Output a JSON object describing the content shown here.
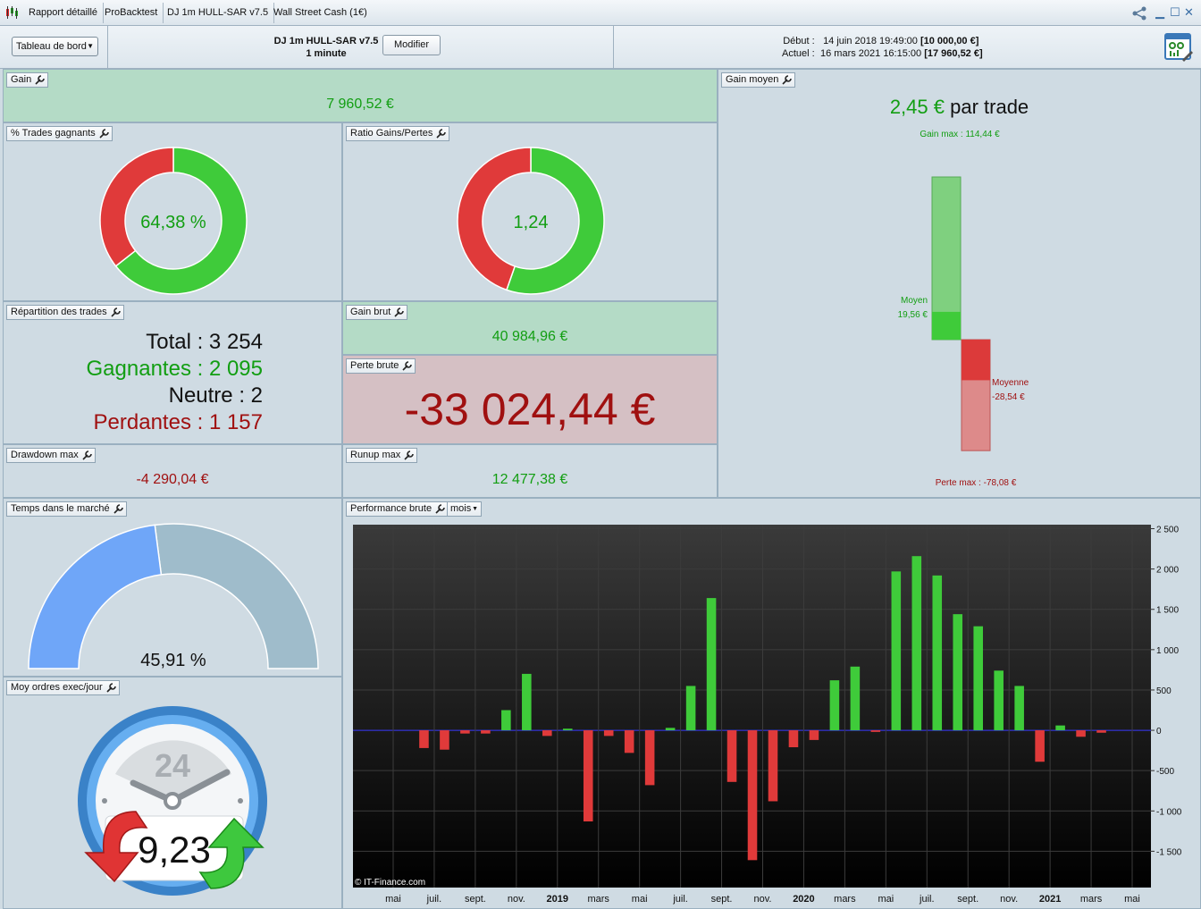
{
  "tabs": [
    "Rapport détaillé",
    "ProBacktest",
    "DJ 1m HULL-SAR v7.5",
    "Wall Street Cash (1€)"
  ],
  "header": {
    "dashboard_label": "Tableau de bord",
    "strategy_name": "DJ 1m HULL-SAR v7.5",
    "timeframe": "1 minute",
    "modify_label": "Modifier",
    "start_label": "Début :",
    "start_date": "14 juin 2018 19:49:00",
    "start_capital": "[10 000,00 €]",
    "current_label": "Actuel :",
    "current_date": "16 mars 2021 16:15:00",
    "current_capital": "[17 960,52 €]"
  },
  "panels": {
    "gain": {
      "title": "Gain",
      "value": "7 960,52 €"
    },
    "win_rate": {
      "title": "% Trades gagnants",
      "value": "64,38 %",
      "fraction": 0.6438
    },
    "ratio": {
      "title": "Ratio Gains/Pertes",
      "value": "1,24",
      "fraction": 0.5536
    },
    "gain_moyen": {
      "title": "Gain moyen",
      "value_num": "2,45 €",
      "value_suffix": "par trade",
      "gain_max_label": "Gain max : 114,44 €",
      "moyen_label": "Moyen",
      "moyen_value": "19,56 €",
      "moyenne_label": "Moyenne",
      "moyenne_value": "-28,54 €",
      "perte_max_label": "Perte max : -78,08 €",
      "gain_max": 114.44,
      "gain_avg": 19.56,
      "loss_avg": -28.54,
      "loss_max": -78.08
    },
    "repartition": {
      "title": "Répartition des trades",
      "total": "Total : 3 254",
      "gagnantes": "Gagnantes : 2 095",
      "neutre": "Neutre : 2",
      "perdantes": "Perdantes : 1 157"
    },
    "gain_brut": {
      "title": "Gain brut",
      "value": "40 984,96 €"
    },
    "perte_brute": {
      "title": "Perte brute",
      "value": "-33 024,44 €"
    },
    "drawdown": {
      "title": "Drawdown max",
      "value": "-4 290,04 €"
    },
    "runup": {
      "title": "Runup max",
      "value": "12 477,38 €"
    },
    "temps_marche": {
      "title": "Temps dans le marché",
      "value": "45,91 %",
      "fraction": 0.4591
    },
    "ordres": {
      "title": "Moy ordres exec/jour",
      "value": "9,23",
      "clock_label": "24"
    },
    "performance": {
      "title": "Performance brute",
      "period": "mois",
      "copyright": "© IT-Finance.com"
    }
  },
  "colors": {
    "green": "#3fcb3a",
    "red": "#e03a3a",
    "gain_text": "#129e12",
    "loss_text": "#a01010"
  },
  "chart_data": {
    "type": "bar",
    "title": "Performance brute",
    "ylim": [
      -1950,
      2550
    ],
    "yticks": [
      2500,
      2000,
      1500,
      1000,
      500,
      0,
      -500,
      -1000,
      -1500
    ],
    "ytick_labels": [
      "2 500",
      "2 000",
      "1 500",
      "1 000",
      "500",
      "0",
      "-500",
      "-1 000",
      "-1 500"
    ],
    "xtick_labels": [
      "mai",
      "juil.",
      "sept.",
      "nov.",
      "2019",
      "mars",
      "mai",
      "juil.",
      "sept.",
      "nov.",
      "2020",
      "mars",
      "mai",
      "juil.",
      "sept.",
      "nov.",
      "2021",
      "mars",
      "mai"
    ],
    "xtick_bold": [
      false,
      false,
      false,
      false,
      true,
      false,
      false,
      false,
      false,
      false,
      true,
      false,
      false,
      false,
      false,
      false,
      true,
      false,
      false
    ],
    "categories": [
      "2018-06",
      "2018-07",
      "2018-08",
      "2018-09",
      "2018-10",
      "2018-11",
      "2018-12",
      "2019-01",
      "2019-02",
      "2019-03",
      "2019-04",
      "2019-05",
      "2019-06",
      "2019-07",
      "2019-08",
      "2019-09",
      "2019-10",
      "2019-11",
      "2019-12",
      "2020-01",
      "2020-02",
      "2020-03",
      "2020-04",
      "2020-05",
      "2020-06",
      "2020-07",
      "2020-08",
      "2020-09",
      "2020-10",
      "2020-11",
      "2020-12",
      "2021-01",
      "2021-02",
      "2021-03"
    ],
    "values": [
      -220,
      -240,
      -40,
      -40,
      250,
      700,
      -70,
      20,
      -1130,
      -70,
      -280,
      -680,
      30,
      550,
      1640,
      -640,
      -1610,
      -880,
      -210,
      -120,
      620,
      790,
      -20,
      1970,
      2160,
      1920,
      1440,
      1290,
      740,
      550,
      -390,
      60,
      -80,
      -30
    ]
  }
}
